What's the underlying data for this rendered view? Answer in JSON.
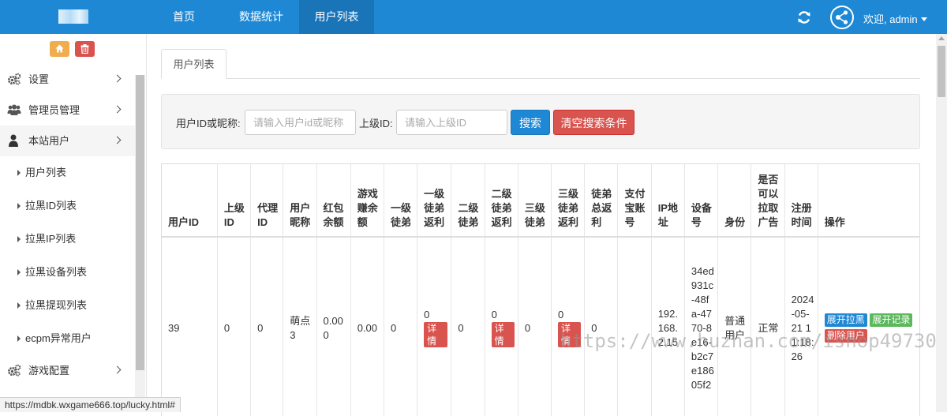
{
  "navbar": {
    "items": [
      "首页",
      "数据统计",
      "用户列表"
    ],
    "active_index": 2,
    "welcome": "欢迎, admin",
    "colors": {
      "bar": "#1e88d5",
      "active": "#1a74b8"
    }
  },
  "sidebar": {
    "top_buttons": [
      {
        "icon": "home-icon",
        "color": "#f0ad4e"
      },
      {
        "icon": "trash-icon",
        "color": "#d9534f"
      }
    ],
    "menu": [
      {
        "label": "设置",
        "icon": "gears-icon"
      },
      {
        "label": "管理员管理",
        "icon": "users-icon"
      },
      {
        "label": "本站用户",
        "icon": "user-icon"
      }
    ],
    "submenu": [
      "用户列表",
      "拉黑ID列表",
      "拉黑IP列表",
      "拉黑设备列表",
      "拉黑提现列表",
      "ecpm异常用户"
    ],
    "menu_after": [
      {
        "label": "游戏配置",
        "icon": "gears-icon"
      }
    ]
  },
  "main": {
    "tab": "用户列表",
    "search": {
      "user_label": "用户ID或昵称:",
      "user_placeholder": "请输入用户id或昵称",
      "parent_label": "上级ID:",
      "parent_placeholder": "请输入上级ID",
      "search_button": "搜索",
      "clear_button": "清空搜索条件"
    },
    "table": {
      "headers": [
        "用户ID",
        "上级ID",
        "代理ID",
        "用户昵称",
        "红包余额",
        "游戏赚余额",
        "一级徒弟",
        "一级徒弟返利",
        "二级徒弟",
        "二级徒弟返利",
        "三级徒弟",
        "三级徒弟返利",
        "徒弟总返利",
        "支付宝账号",
        "IP地址",
        "设备号",
        "身份",
        "是否可以拉取广告",
        "注册时间",
        "操作"
      ],
      "row": {
        "user_id": "39",
        "parent_id": "0",
        "agent_id": "0",
        "nickname": "萌点3",
        "red_packet": "0.000",
        "game_balance": "0.00",
        "level1": "0",
        "level1_rebate": "0",
        "level2": "0",
        "level2_rebate": "0",
        "level3": "0",
        "level3_rebate": "0",
        "total_rebate": "0",
        "alipay": "",
        "ip": "192.168.2.15",
        "device": "34ed931c-48fa-4770-8e16-b2c7e18605f2",
        "identity": "普通用户",
        "can_pull_ads": "正常",
        "reg_time": "2024-05-21 11:18:26",
        "detail_label": "详情",
        "ops": [
          "展开拉黑",
          "展开记录",
          "删除用户"
        ]
      }
    }
  },
  "status_url": "https://mdbk.wxgame666.top/lucky.html#",
  "watermark": "https://www.huzhan.com/ishop49730"
}
